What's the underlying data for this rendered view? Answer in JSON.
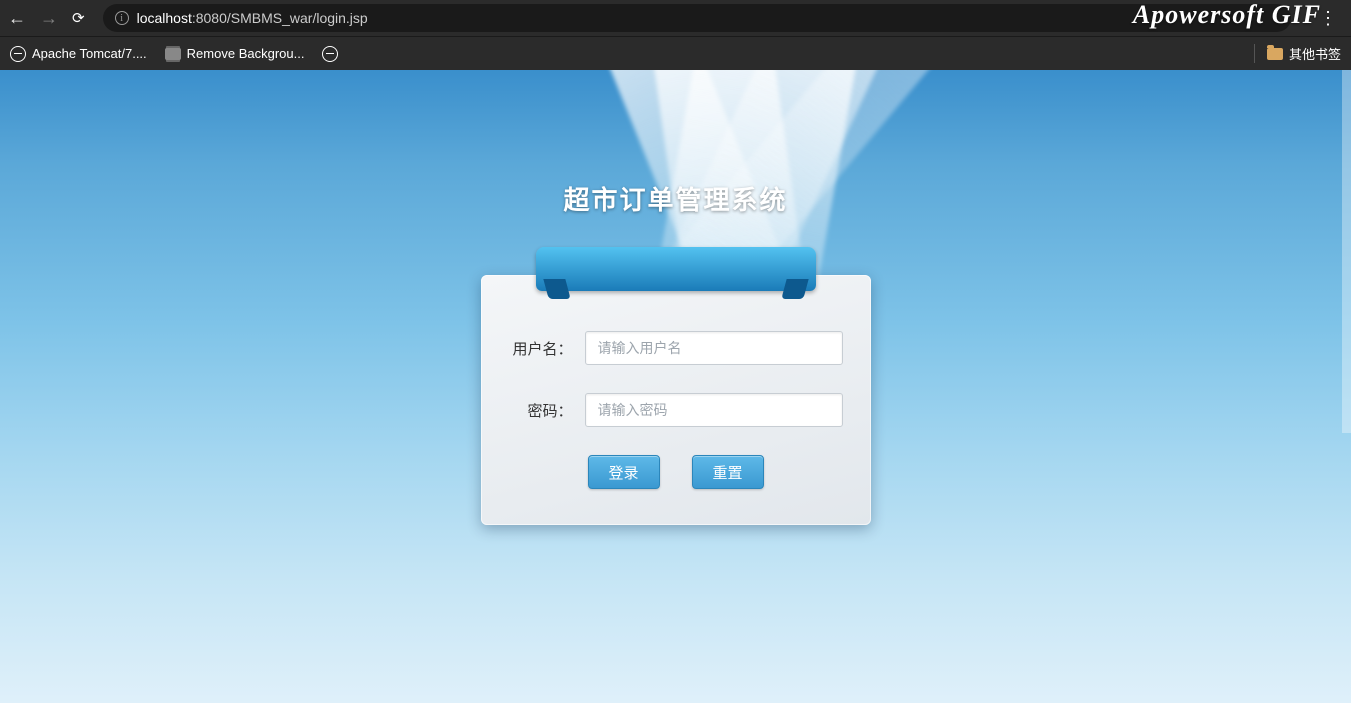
{
  "browser": {
    "url_prefix": "localhost",
    "url_rest": ":8080/SMBMS_war/login.jsp",
    "watermark": "Apowersoft GIF"
  },
  "bookmarks": {
    "items": [
      {
        "label": "Apache Tomcat/7...."
      },
      {
        "label": "Remove Backgrou..."
      },
      {
        "label": ""
      }
    ],
    "other": "其他书签"
  },
  "page": {
    "title": "超市订单管理系统"
  },
  "form": {
    "username_label": "用户名：",
    "username_placeholder": "请输入用户名",
    "password_label": "密码：",
    "password_placeholder": "请输入密码",
    "login_button": "登录",
    "reset_button": "重置"
  }
}
